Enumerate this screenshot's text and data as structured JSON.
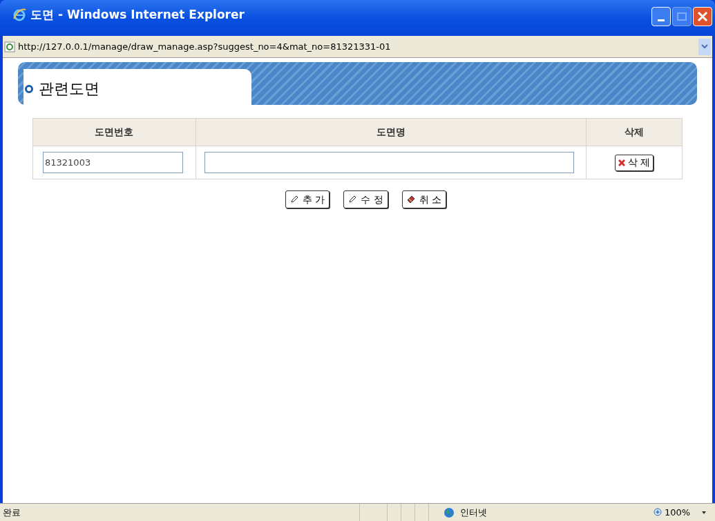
{
  "window": {
    "title": "도면 - Windows Internet Explorer"
  },
  "address_bar": {
    "url": "http://127.0.0.1/manage/draw_manage.asp?suggest_no=4&mat_no=81321331-01"
  },
  "page": {
    "heading": "관련도면"
  },
  "table": {
    "columns": [
      "도면번호",
      "도면명",
      "삭제"
    ],
    "rows": [
      {
        "drawing_number": "81321003",
        "delete_button": "삭 제"
      }
    ]
  },
  "actions": [
    {
      "kind": "pencil",
      "label": "추 가"
    },
    {
      "kind": "pencil",
      "label": "수 정"
    },
    {
      "kind": "eraser",
      "label": "취 소"
    }
  ],
  "status_bar": {
    "status": "완료",
    "zone": "인터넷",
    "zoom": "100%"
  }
}
